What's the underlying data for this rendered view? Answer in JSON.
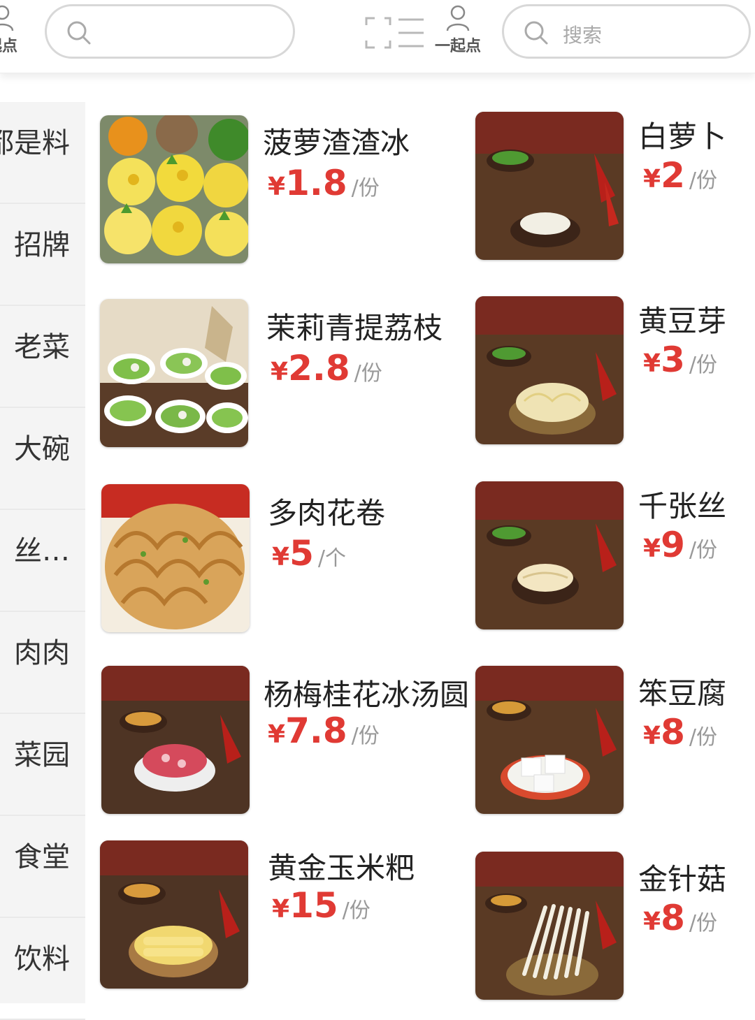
{
  "header": {
    "left_user_label": "起点",
    "right_user_label": "一起点",
    "search_left_placeholder": "",
    "search_right_placeholder": "搜索"
  },
  "sidebar": {
    "items": [
      {
        "label": "都是料"
      },
      {
        "label": "招牌"
      },
      {
        "label": "老菜"
      },
      {
        "label": "大碗"
      },
      {
        "label": "丝…"
      },
      {
        "label": "肉肉"
      },
      {
        "label": "菜园"
      },
      {
        "label": "食堂"
      },
      {
        "label": "饮料"
      }
    ]
  },
  "products": [
    {
      "name": "菠萝渣渣冰",
      "currency": "¥",
      "price": "1.8",
      "unit": "/份"
    },
    {
      "name": "白萝卜",
      "currency": "¥",
      "price": "2",
      "unit": "/份"
    },
    {
      "name": "茉莉青提荔枝",
      "currency": "¥",
      "price": "2.8",
      "unit": "/份"
    },
    {
      "name": "黄豆芽",
      "currency": "¥",
      "price": "3",
      "unit": "/份"
    },
    {
      "name": "多肉花卷",
      "currency": "¥",
      "price": "5",
      "unit": "/个"
    },
    {
      "name": "千张丝",
      "currency": "¥",
      "price": "9",
      "unit": "/份"
    },
    {
      "name": "杨梅桂花冰汤圆",
      "currency": "¥",
      "price": "7.8",
      "unit": "/份"
    },
    {
      "name": "笨豆腐",
      "currency": "¥",
      "price": "8",
      "unit": "/份"
    },
    {
      "name": "黄金玉米粑",
      "currency": "¥",
      "price": "15",
      "unit": "/份"
    },
    {
      "name": "金针菇",
      "currency": "¥",
      "price": "8",
      "unit": "/份"
    }
  ],
  "colors": {
    "price_red": "#e03a34",
    "sidebar_bg": "#f4f4f4",
    "unit_gray": "#999999"
  }
}
